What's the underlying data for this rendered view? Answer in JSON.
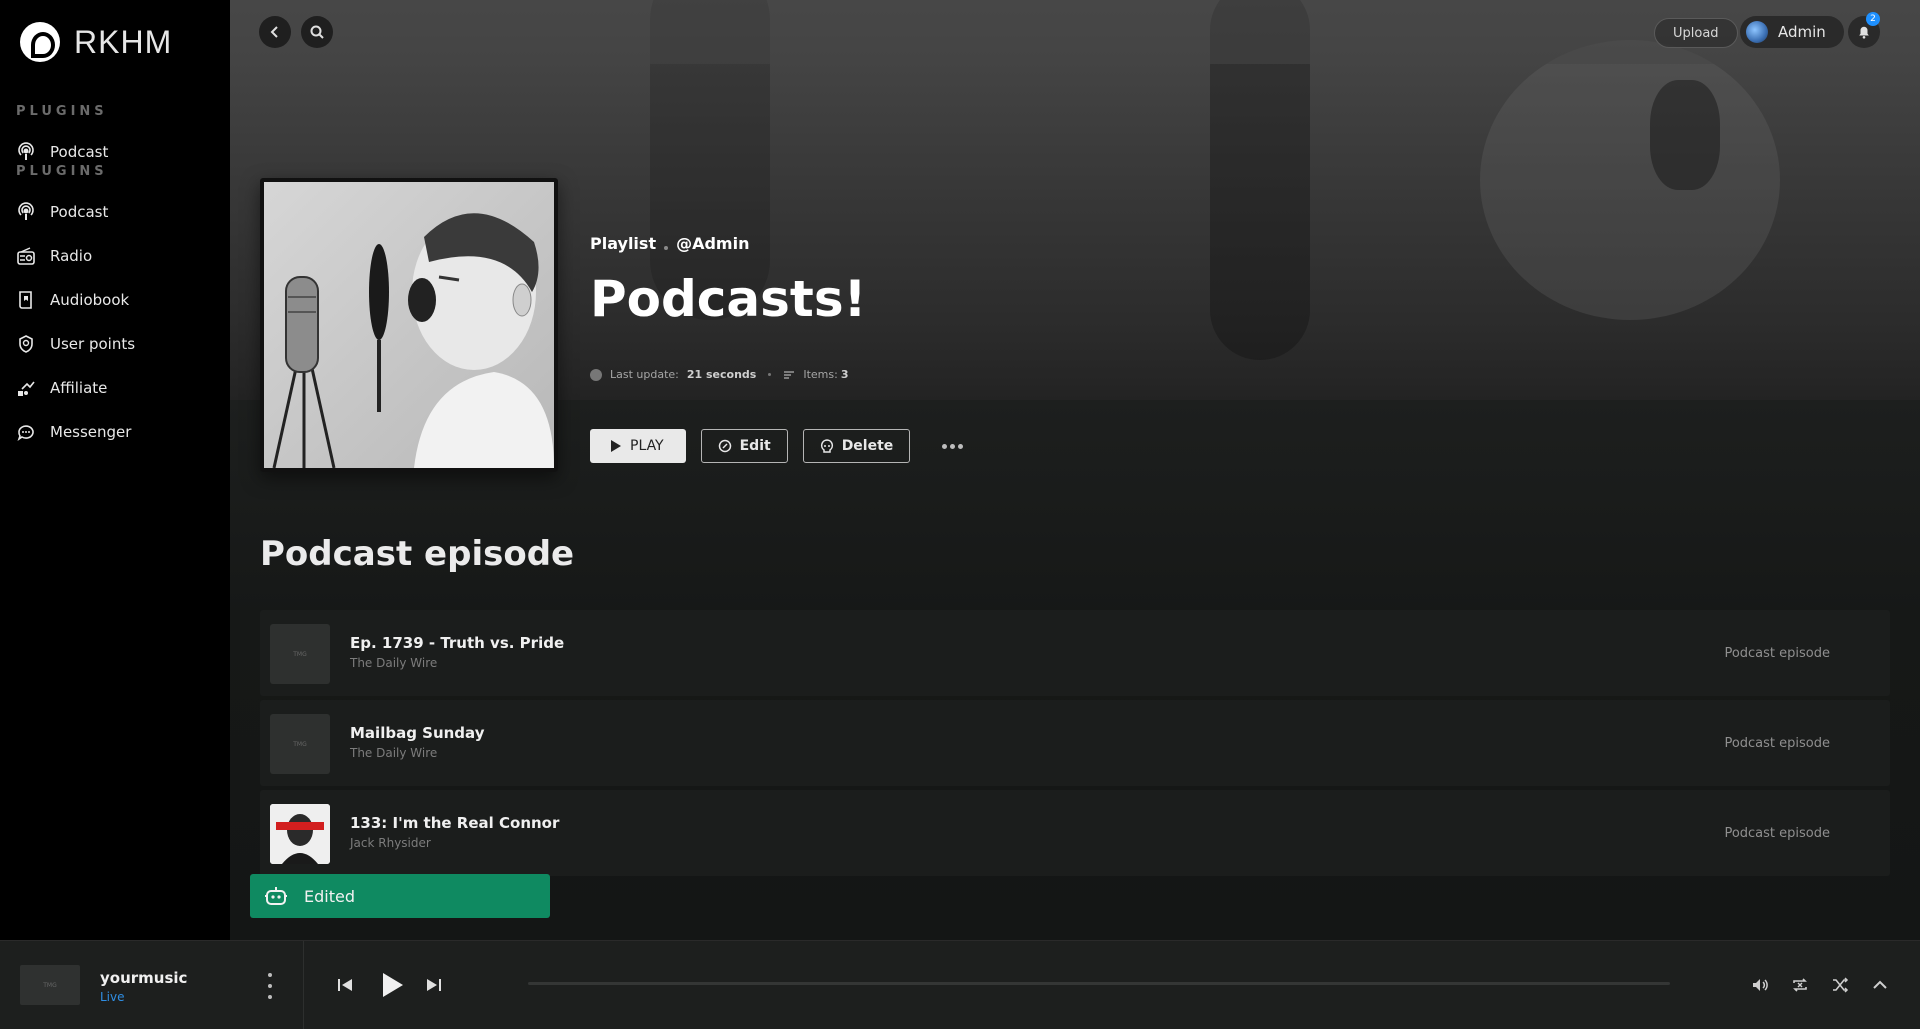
{
  "brand": {
    "name": "RKHM"
  },
  "sidebar": {
    "heading_1": "PLUGINS",
    "heading_2": "PLUGINS",
    "top_item": {
      "label": "Podcast",
      "icon": "podcast-icon"
    },
    "items": [
      {
        "label": "Podcast",
        "icon": "podcast-icon"
      },
      {
        "label": "Radio",
        "icon": "radio-icon"
      },
      {
        "label": "Audiobook",
        "icon": "audiobook-icon"
      },
      {
        "label": "User points",
        "icon": "badge-icon"
      },
      {
        "label": "Affiliate",
        "icon": "affiliate-icon"
      },
      {
        "label": "Messenger",
        "icon": "chat-icon"
      }
    ]
  },
  "header": {
    "upload_label": "Upload",
    "user_name": "Admin",
    "notification_count": "2"
  },
  "playlist": {
    "type_label": "Playlist",
    "owner": "@Admin",
    "title": "Podcasts!",
    "last_update_label": "Last update:",
    "last_update_value": "21 seconds",
    "items_label": "Items:",
    "items_value": "3"
  },
  "actions": {
    "play_label": "PLAY",
    "edit_label": "Edit",
    "delete_label": "Delete"
  },
  "section_title": "Podcast episode",
  "episodes": [
    {
      "title": "Ep. 1739 - Truth vs. Pride",
      "artist": "The Daily Wire",
      "type": "Podcast episode",
      "thumb_text": "TMG"
    },
    {
      "title": "Mailbag Sunday",
      "artist": "The Daily Wire",
      "type": "Podcast episode",
      "thumb_text": "TMG"
    },
    {
      "title": "133: I'm the Real Connor",
      "artist": "Jack Rhysider",
      "type": "Podcast episode",
      "thumb_text": ""
    }
  ],
  "toast": {
    "message": "Edited"
  },
  "player": {
    "title": "yourmusic",
    "subtitle": "Live",
    "thumb_text": "TMG",
    "progress": 0
  },
  "colors": {
    "accent_blue": "#2f8ee3",
    "toast_green": "#0f8a61",
    "sidebar_bg": "#000000"
  }
}
